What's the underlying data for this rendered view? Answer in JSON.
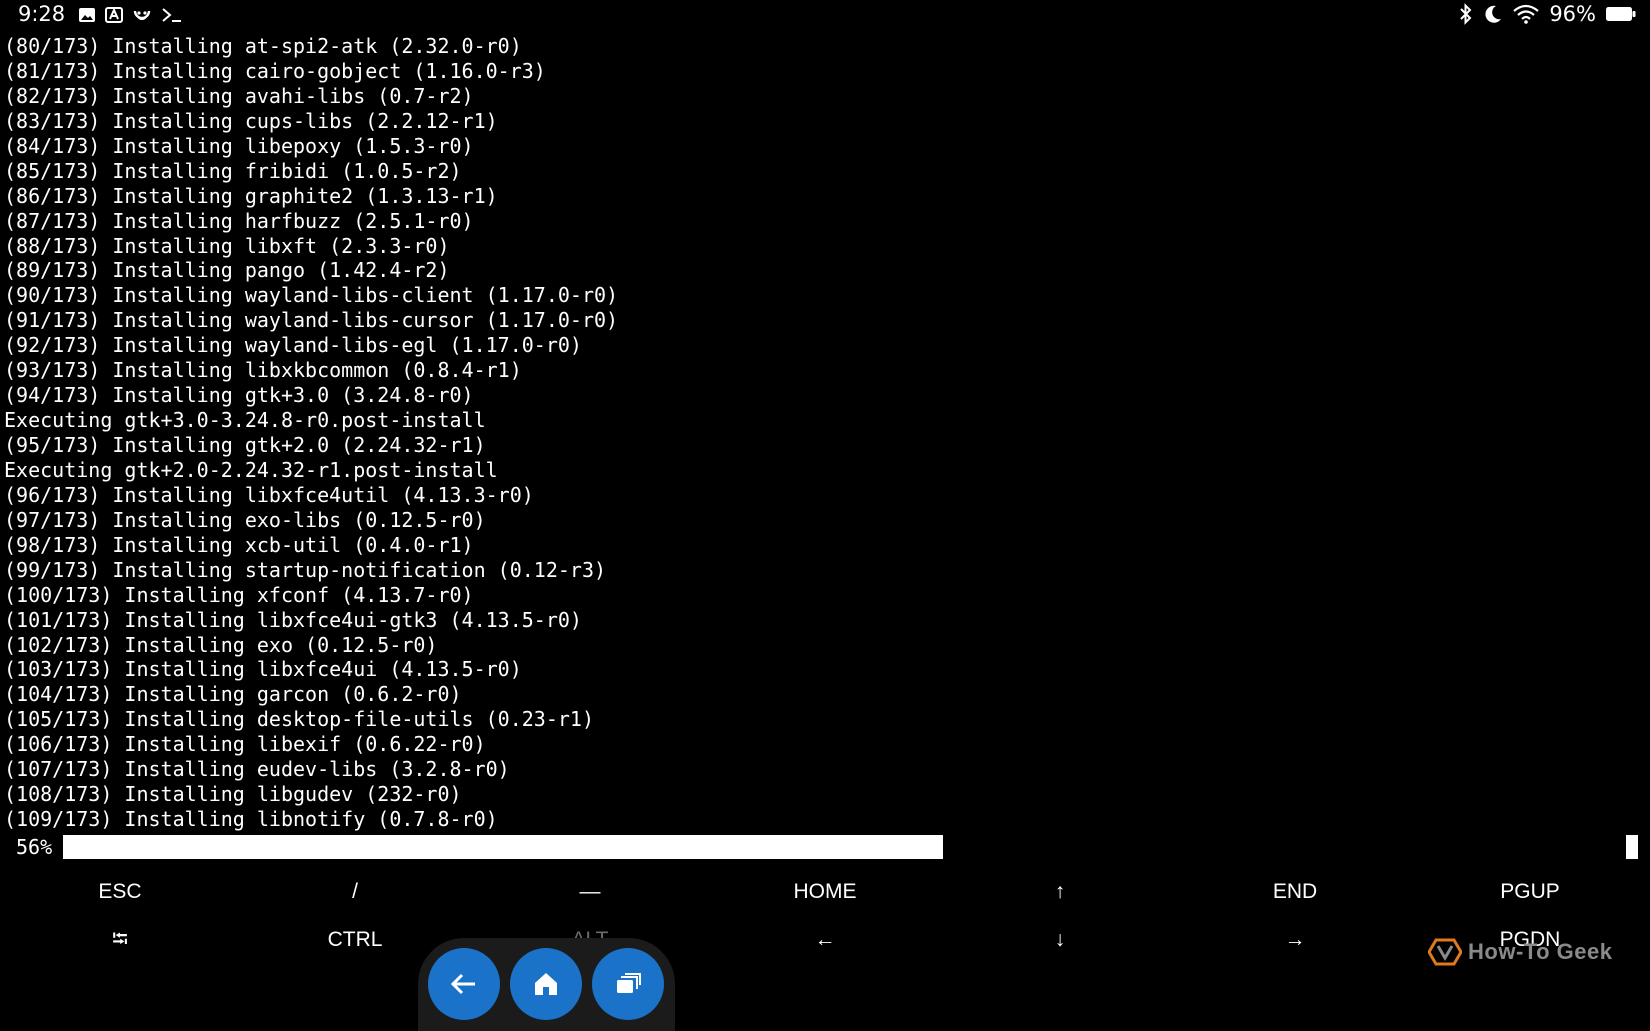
{
  "status_bar": {
    "time": "9:28",
    "left_icons": [
      "image-icon",
      "text-a-icon",
      "smiley-icon",
      "terminal-icon"
    ],
    "right_icons": [
      "bluetooth-icon",
      "moon-icon",
      "wifi-icon"
    ],
    "battery_percent": "96%"
  },
  "terminal": {
    "lines": [
      "(80/173) Installing at-spi2-atk (2.32.0-r0)",
      "(81/173) Installing cairo-gobject (1.16.0-r3)",
      "(82/173) Installing avahi-libs (0.7-r2)",
      "(83/173) Installing cups-libs (2.2.12-r1)",
      "(84/173) Installing libepoxy (1.5.3-r0)",
      "(85/173) Installing fribidi (1.0.5-r2)",
      "(86/173) Installing graphite2 (1.3.13-r1)",
      "(87/173) Installing harfbuzz (2.5.1-r0)",
      "(88/173) Installing libxft (2.3.3-r0)",
      "(89/173) Installing pango (1.42.4-r2)",
      "(90/173) Installing wayland-libs-client (1.17.0-r0)",
      "(91/173) Installing wayland-libs-cursor (1.17.0-r0)",
      "(92/173) Installing wayland-libs-egl (1.17.0-r0)",
      "(93/173) Installing libxkbcommon (0.8.4-r1)",
      "(94/173) Installing gtk+3.0 (3.24.8-r0)",
      "Executing gtk+3.0-3.24.8-r0.post-install",
      "(95/173) Installing gtk+2.0 (2.24.32-r1)",
      "Executing gtk+2.0-2.24.32-r1.post-install",
      "(96/173) Installing libxfce4util (4.13.3-r0)",
      "(97/173) Installing exo-libs (0.12.5-r0)",
      "(98/173) Installing xcb-util (0.4.0-r1)",
      "(99/173) Installing startup-notification (0.12-r3)",
      "(100/173) Installing xfconf (4.13.7-r0)",
      "(101/173) Installing libxfce4ui-gtk3 (4.13.5-r0)",
      "(102/173) Installing exo (0.12.5-r0)",
      "(103/173) Installing libxfce4ui (4.13.5-r0)",
      "(104/173) Installing garcon (0.6.2-r0)",
      "(105/173) Installing desktop-file-utils (0.23-r1)",
      "(106/173) Installing libexif (0.6.22-r0)",
      "(107/173) Installing eudev-libs (3.2.8-r0)",
      "(108/173) Installing libgudev (232-r0)",
      "(109/173) Installing libnotify (0.7.8-r0)"
    ],
    "progress_label": "56%",
    "progress_fraction": 0.56
  },
  "extra_keys": {
    "row1": [
      "ESC",
      "/",
      "—",
      "HOME",
      "↑",
      "END",
      "PGUP"
    ],
    "row2": [
      "⭾",
      "CTRL",
      "ALT",
      "←",
      "↓",
      "→",
      "PGDN"
    ]
  },
  "nav_bar": {
    "buttons": [
      "back-arrow-icon",
      "home-icon",
      "recent-apps-icon"
    ]
  },
  "watermark": {
    "text": "How-To Geek"
  },
  "colors": {
    "nav_button": "#1a73c8",
    "background": "#000000",
    "text": "#ffffff"
  }
}
